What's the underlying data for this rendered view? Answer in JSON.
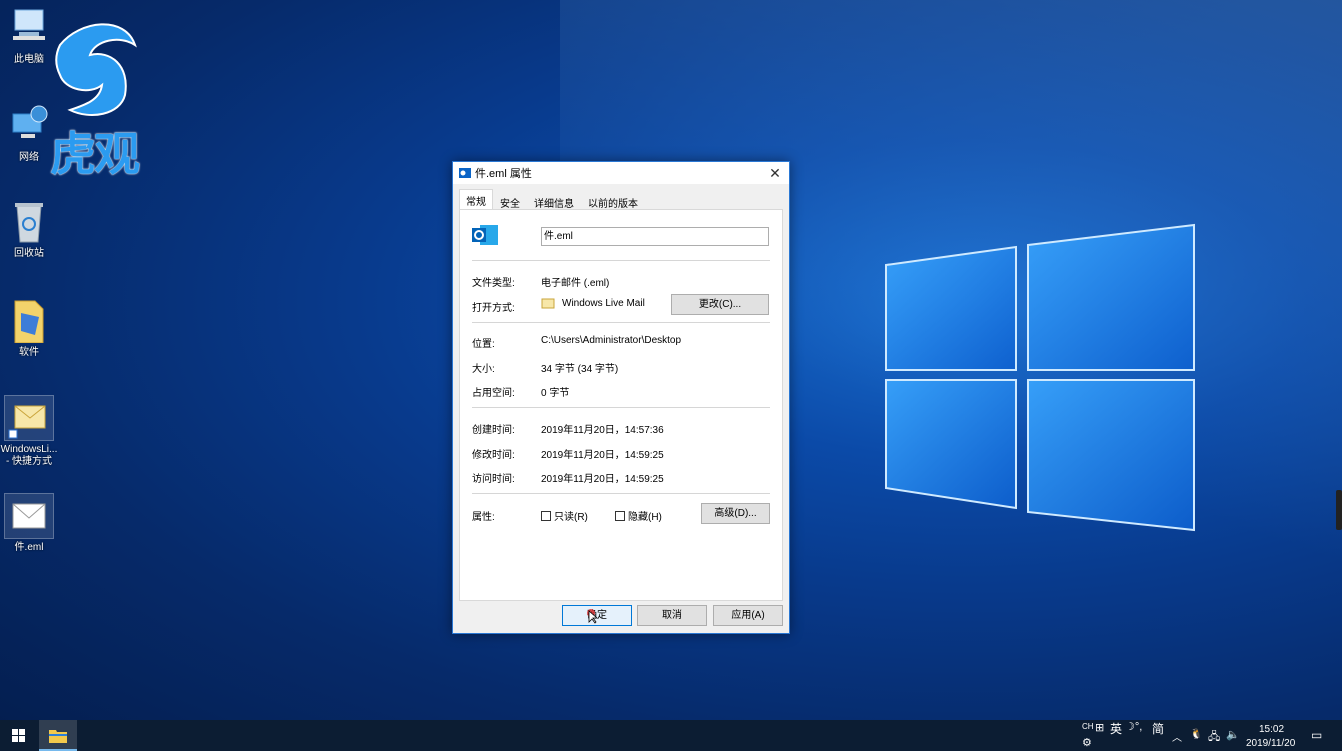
{
  "watermark": {
    "text": "虎观"
  },
  "desktop_icons": [
    {
      "label": "此电脑"
    },
    {
      "label": "网络"
    },
    {
      "label": "回收站"
    },
    {
      "label": "软件"
    },
    {
      "label": "WindowsLi...\n- 快捷方式"
    },
    {
      "label": "件.eml"
    }
  ],
  "dialog": {
    "title": "件.eml 属性",
    "tabs": [
      "常规",
      "安全",
      "详细信息",
      "以前的版本"
    ],
    "filename": "件.eml",
    "file_type_label": "文件类型:",
    "file_type_value": "电子邮件 (.eml)",
    "open_with_label": "打开方式:",
    "open_with_value": "Windows Live Mail",
    "change_button": "更改(C)...",
    "location_label": "位置:",
    "location_value": "C:\\Users\\Administrator\\Desktop",
    "size_label": "大小:",
    "size_value": "34 字节 (34 字节)",
    "size_on_disk_label": "占用空间:",
    "size_on_disk_value": "0 字节",
    "created_label": "创建时间:",
    "created_value": "2019年11月20日，14:57:36",
    "modified_label": "修改时间:",
    "modified_value": "2019年11月20日，14:59:25",
    "accessed_label": "访问时间:",
    "accessed_value": "2019年11月20日，14:59:25",
    "attributes_label": "属性:",
    "readonly_label": "只读(R)",
    "hidden_label": "隐藏(H)",
    "advanced_button": "高级(D)...",
    "ok_button": "确定",
    "cancel_button": "取消",
    "apply_button": "应用(A)"
  },
  "taskbar": {
    "ime": [
      "CH",
      "英",
      "简"
    ],
    "time": "15:02",
    "date": "2019/11/20"
  },
  "colors": {
    "accent": "#0078d7",
    "taskbar": "#0c1d33"
  }
}
